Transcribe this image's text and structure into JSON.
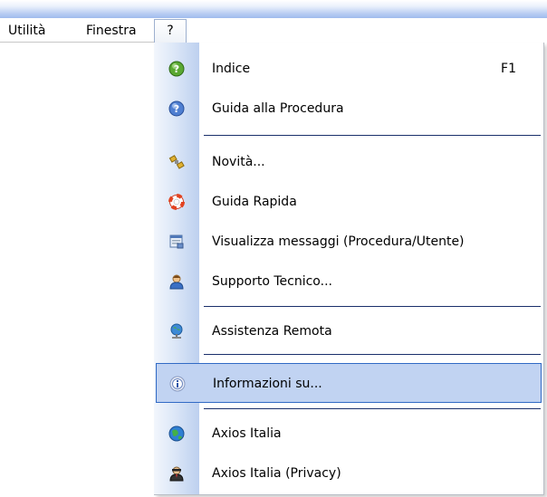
{
  "menubar": {
    "items": [
      {
        "label": "Utilità"
      },
      {
        "label": "Finestra"
      },
      {
        "label": "?"
      }
    ]
  },
  "help_menu": {
    "items": [
      {
        "label": "Indice",
        "shortcut": "F1",
        "icon": "help-green-icon"
      },
      {
        "label": "Guida alla Procedura",
        "icon": "help-blue-icon"
      },
      {
        "label": "Novità...",
        "icon": "satellite-icon"
      },
      {
        "label": "Guida Rapida",
        "icon": "lifebuoy-icon"
      },
      {
        "label": "Visualizza messaggi (Procedura/Utente)",
        "icon": "messages-window-icon"
      },
      {
        "label": "Supporto Tecnico...",
        "icon": "support-user-icon"
      },
      {
        "label": "Assistenza Remota",
        "icon": "remote-assistance-icon"
      },
      {
        "label": "Informazioni su...",
        "icon": "info-icon",
        "highlighted": true
      },
      {
        "label": "Axios Italia",
        "icon": "globe-icon"
      },
      {
        "label": "Axios Italia (Privacy)",
        "icon": "privacy-agent-icon"
      }
    ]
  },
  "colors": {
    "highlight_fill": "#c1d3f2",
    "highlight_border": "#316ac5",
    "separator": "#1a2f6b"
  }
}
